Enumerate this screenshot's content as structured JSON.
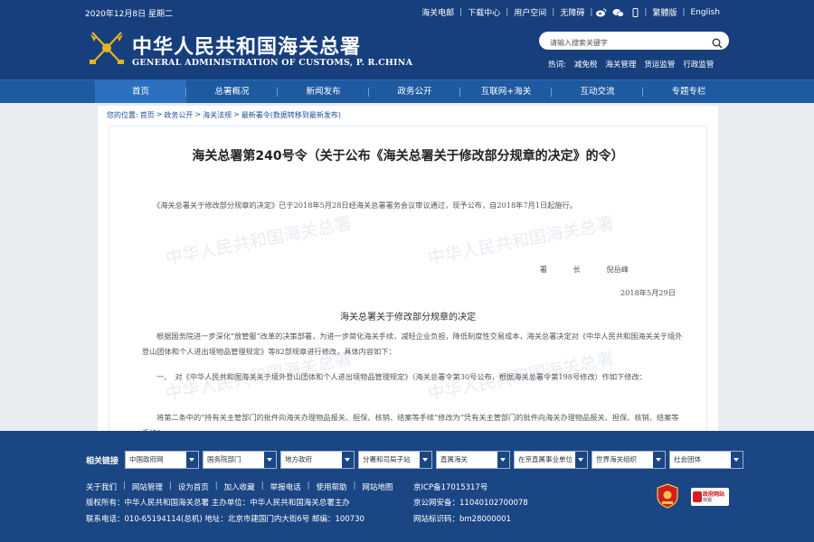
{
  "header": {
    "date": "2020年12月8日 星期二",
    "top_links": [
      "海关电邮",
      "下载中心",
      "用户空间",
      "无障碍",
      "繁體版",
      "English"
    ],
    "title_cn": "中华人民共和国海关总署",
    "title_en": "GENERAL ADMINISTRATION OF CUSTOMS, P. R.CHINA",
    "search_placeholder": "请输入搜索关键字",
    "hot_label": "热词:",
    "hot_words": [
      "减免税",
      "海关管理",
      "货运监管",
      "行政监管"
    ]
  },
  "nav": {
    "items": [
      "首页",
      "总署概况",
      "新闻发布",
      "政务公开",
      "互联网+海关",
      "互动交流",
      "专题专栏"
    ]
  },
  "breadcrumb": [
    "您的位置:",
    "首页",
    ">",
    "政务公开",
    ">",
    "海关法规",
    ">",
    "最新署令(数据转移到最新发布)"
  ],
  "article": {
    "title": "海关总署第240号令（关于公布《海关总署关于修改部分规章的决定》的令）",
    "intro": "《海关总署关于修改部分规章的决定》已于2018年5月28日经海关总署署务会议审议通过，现予公布，自2018年7月1日起施行。",
    "sign_title1": "署",
    "sign_title2": "长",
    "sign_name": "倪岳峰",
    "sign_date": "2018年5月29日",
    "subtitle": "海关总署关于修改部分规章的决定",
    "para1": "根据国务院进一步深化“放管服”改革的决策部署，为进一步简化海关手续，减轻企业负担，降低制度性交易成本，海关总署决定对《中华人民共和国海关关于境外登山团体和个人进出境物品管理规定》等82部规章进行修改，具体内容如下：",
    "para2": "一、　对《中华人民共和国海关关于境外登山团体和个人进出境物品管理规定》（海关总署令第30号公布，根据海关总署令第198号修改）作如下修改：",
    "para3": "将第二条中的“持有关主管部门的批件向海关办理物品报关、担保、核销、结案等手续”修改为“凭有关主管部门的批件向海关办理物品报关、担保、核销、结案等手续”。",
    "watermark": "中华人民共和国海关总署"
  },
  "footer": {
    "related_label": "相关链接",
    "selects": [
      "中国政府网",
      "国务院部门",
      "地方政府",
      "分署和司局子站",
      "直属海关",
      "在京直属事业单位",
      "世界海关组织",
      "社会团体"
    ],
    "links": [
      "关于我们",
      "网站管理",
      "设为首页",
      "加入收藏",
      "举报电话",
      "使用帮助",
      "网站地图"
    ],
    "copyright": "版权所有：中华人民共和国海关总署 主办单位：中华人民共和国海关总署主办",
    "contact": "联系电话：010-65194114(总机) 地址：北京市建国门内大街6号 邮编：100730",
    "icp": "京ICP备17015317号",
    "police": "京公网安备：11040102700078",
    "cert": "网站标识码：bm28000001",
    "badge2_title": "政府网站",
    "badge2_sub": "找错"
  },
  "colors": {
    "header_bg": "#173f7d",
    "nav_bg": "#1e5aa0",
    "nav_active": "#2c70c0",
    "footer_bg": "#1b4684",
    "link_blue": "#1d4f95"
  }
}
